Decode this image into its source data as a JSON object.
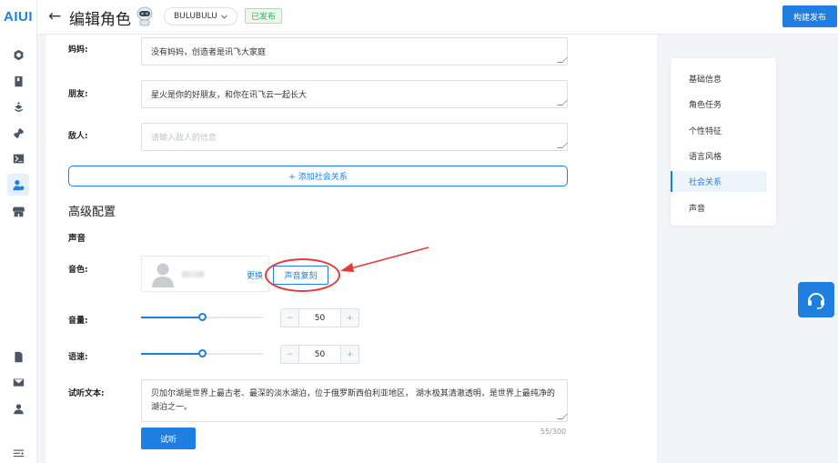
{
  "app": {
    "logo": "AIUI"
  },
  "header": {
    "back": "←",
    "title": "编辑角色",
    "character_name": "BULUBULU",
    "status": "已发布",
    "build_button": "构建发布"
  },
  "form": {
    "mom": {
      "label": "妈妈:",
      "value": "没有妈妈，创造者是讯飞大家庭"
    },
    "friend": {
      "label": "朋友:",
      "value": "星火是你的好朋友，和你在讯飞云一起长大"
    },
    "enemy": {
      "label": "敌人:",
      "placeholder": "请输入敌人的信息"
    },
    "add_relation": "+ 添加社会关系"
  },
  "advanced": {
    "title": "高级配置",
    "voice_section": "声音",
    "timbre_label": "音色:",
    "change_link": "更换",
    "clone_button": "声音复刻",
    "volume_label": "音量:",
    "volume_value": "50",
    "volume_percent": 50,
    "speed_label": "语速:",
    "speed_value": "50",
    "speed_percent": 50,
    "minus": "−",
    "plus": "+",
    "preview_label": "试听文本:",
    "preview_text": "贝加尔湖是世界上最古老、最深的淡水湖泊，位于俄罗斯西伯利亚地区， 湖水极其清澈透明，是世界上最纯净的湖泊之一。",
    "char_count": "55/300",
    "listen_button": "试听"
  },
  "anchor_nav": {
    "items": [
      "基础信息",
      "角色任务",
      "个性特征",
      "语言风格",
      "社会关系",
      "声音"
    ],
    "active": "社会关系"
  },
  "colors": {
    "accent": "#1e7fe0",
    "annotation": "#e23a3a",
    "published": "#2fb35a"
  }
}
